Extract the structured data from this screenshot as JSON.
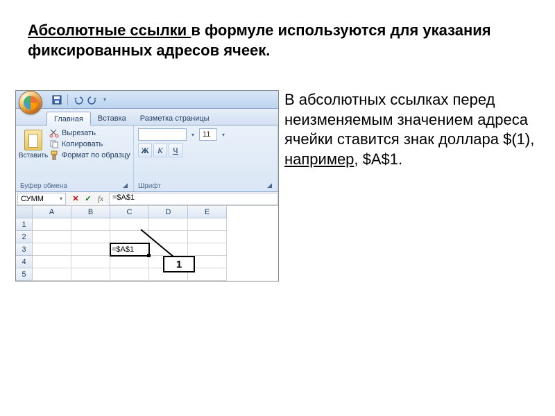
{
  "slide": {
    "title_underlined": "Абсолютные  ссылки ",
    "title_rest": "в формуле используются для указания фиксированных адресов ячеек.",
    "body_1": "В абсолютных ссылках перед неизменяемым значением адреса ячейки ставится знак доллара $(1), ",
    "body_example_word": "например",
    "body_2": ", $A$1."
  },
  "qat": {
    "save": "save-icon",
    "undo": "undo-icon",
    "redo": "redo-icon"
  },
  "tabs": {
    "home": "Главная",
    "insert": "Вставка",
    "layout": "Разметка страницы"
  },
  "ribbon": {
    "paste_label": "Вставить",
    "cut": "Вырезать",
    "copy": "Копировать",
    "format_painter": "Формат по образцу",
    "clipboard_title": "Буфер обмена",
    "font_name": "",
    "font_size": "11",
    "bold": "Ж",
    "italic": "К",
    "underline": "Ч",
    "font_title": "Шрифт"
  },
  "fx": {
    "namebox": "СУММ",
    "cancel": "✕",
    "enter": "✓",
    "fx": "fx",
    "formula": "=$A$1"
  },
  "grid": {
    "cols": [
      "A",
      "B",
      "C",
      "D",
      "E"
    ],
    "rows": [
      "1",
      "2",
      "3",
      "4",
      "5"
    ],
    "active_cell_value": "=$A$1"
  },
  "callout": {
    "label": "1"
  }
}
